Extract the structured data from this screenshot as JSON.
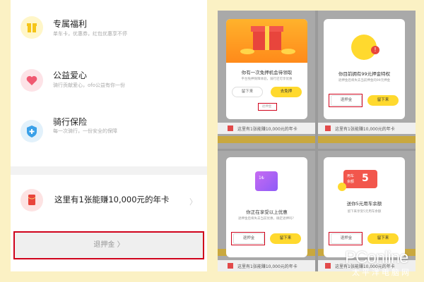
{
  "left": {
    "features": [
      {
        "title": "专属福利",
        "subtitle": "单车卡，优惠券，红包优惠享不停",
        "icon": "gift-icon",
        "icon_bg": "#fff6c8",
        "icon_color": "#f5c518"
      },
      {
        "title": "公益爱心",
        "subtitle": "骑行贡献爱心，ofo公益有你一份",
        "icon": "heart-icon",
        "icon_bg": "#fde3e7",
        "icon_color": "#f05a72"
      },
      {
        "title": "骑行保险",
        "subtitle": "每一次骑行，一份安全的保障",
        "icon": "shield-icon",
        "icon_bg": "#e2f1fb",
        "icon_color": "#3aa0e8"
      }
    ],
    "promo": {
      "text": "这里有1张能赚10,000元的年卡",
      "icon": "red-envelope-icon"
    },
    "refund_label": "退押金"
  },
  "right": {
    "strip_text": "这里有1张能赚10,000元的年卡",
    "panel1": {
      "title": "你有一次免押机会待领取",
      "desc": "平台免押保障体验，骑行还可享优惠",
      "stay_label": "留下来",
      "free_label": "去免押",
      "refund_link": "退押金"
    },
    "panel2": {
      "title": "你目前拥有99元押金特权",
      "desc": "退押金后将失去当前押金的99元押金",
      "refund_label": "退押金",
      "stay_label": "留下来"
    },
    "panel3": {
      "badge": "1₺",
      "title": "你正在享受以上优惠",
      "desc": "退押金后将失去当前优惠，确定退押吗？",
      "refund_label": "退押金",
      "stay_label": "留下来"
    },
    "panel4": {
      "card_line1": "用车",
      "card_line2": "余额",
      "amount": "5",
      "title": "送你5元用车余额",
      "desc": "留下来享受5元用车余额",
      "refund_label": "退押金",
      "stay_label": "留下来"
    }
  },
  "watermark": {
    "brand": "PConline",
    "sub": "太平洋电脑网"
  }
}
